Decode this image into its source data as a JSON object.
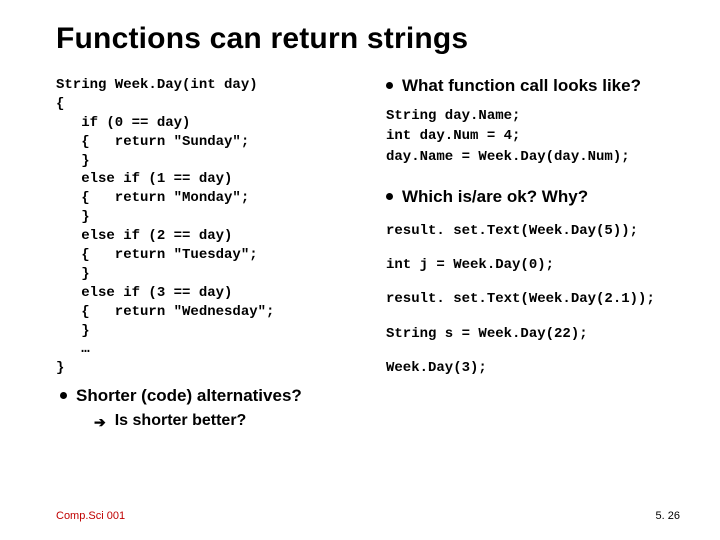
{
  "title": "Functions can return strings",
  "left": {
    "code": "String Week.Day(int day)\n{\n   if (0 == day)\n   {   return \"Sunday\";\n   }\n   else if (1 == day)\n   {   return \"Monday\";\n   }\n   else if (2 == day)\n   {   return \"Tuesday\";\n   }\n   else if (3 == day)\n   {   return \"Wednesday\";\n   }\n   …\n}",
    "bullet": "Shorter (code) alternatives?",
    "sub": "Is shorter better?"
  },
  "right": {
    "q1": "What function call looks like?",
    "code1": "String day.Name;\nint day.Num = 4;\nday.Name = Week.Day(day.Num);",
    "q2": "Which is/are ok? Why?",
    "c1": "result. set.Text(Week.Day(5));",
    "c2": "int j = Week.Day(0);",
    "c3": "result. set.Text(Week.Day(2.1));",
    "c4": "String s = Week.Day(22);",
    "c5": "Week.Day(3);"
  },
  "footer": {
    "left": "Comp.Sci 001",
    "right": "5. 26"
  }
}
